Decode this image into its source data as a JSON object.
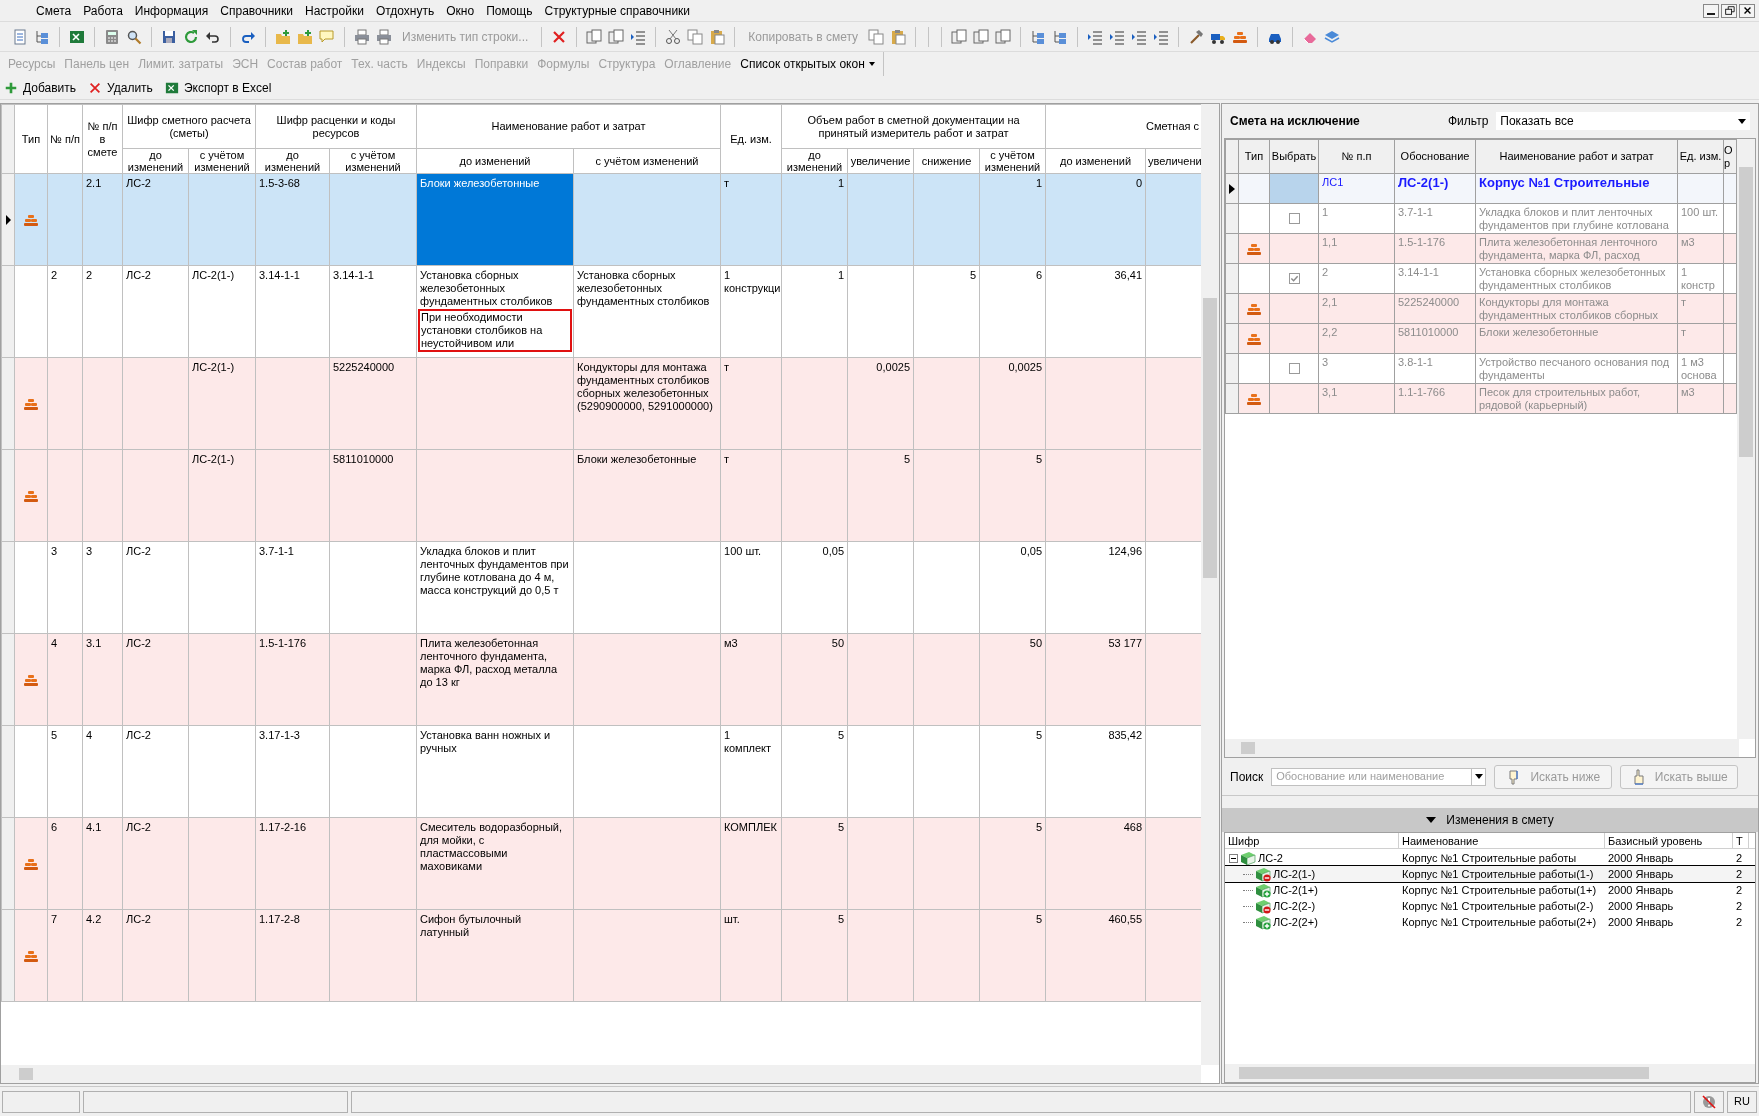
{
  "menu": [
    "Смета",
    "Работа",
    "Информация",
    "Справочники",
    "Настройки",
    "Отдохнуть",
    "Окно",
    "Помощь",
    "Структурные справочники"
  ],
  "toolbar": {
    "buttons": [
      {
        "label": "Изменить тип строки...",
        "disabled": true
      },
      {
        "label": "Копировать в смету",
        "disabled": true
      }
    ]
  },
  "panel_tabs": [
    {
      "label": "Ресурсы",
      "disabled": true
    },
    {
      "label": "Панель цен",
      "disabled": true
    },
    {
      "label": "Лимит. затраты",
      "disabled": true
    },
    {
      "label": "ЭСН",
      "disabled": true
    },
    {
      "label": "Состав работ",
      "disabled": true
    },
    {
      "label": "Тех. часть",
      "disabled": true
    },
    {
      "label": "Индексы",
      "disabled": true
    },
    {
      "label": "Поправки",
      "disabled": true
    },
    {
      "label": "Формулы",
      "disabled": true
    },
    {
      "label": "Структура",
      "disabled": true
    },
    {
      "label": "Оглавление",
      "disabled": true
    }
  ],
  "open_windows_menu": {
    "label": "Список открытых окон"
  },
  "actions": [
    {
      "label": "Добавить",
      "kind": "add"
    },
    {
      "label": "Удалить",
      "kind": "delete"
    },
    {
      "label": "Экспорт в Excel",
      "kind": "excel"
    }
  ],
  "table": {
    "columns": [
      {
        "label": "Тип"
      },
      {
        "label": "№ п/п"
      },
      {
        "label": "№ п/п в смете"
      },
      {
        "label": "Шифр сметного расчета (сметы)",
        "sub": [
          "до изменений",
          "с учётом изменений"
        ]
      },
      {
        "label": "Шифр расценки и коды ресурсов",
        "sub": [
          "до изменений",
          "с учётом изменений"
        ]
      },
      {
        "label": "Наименование работ и затрат",
        "sub": [
          "до изменений",
          "с учётом изменений"
        ]
      },
      {
        "label": "Ед. изм."
      },
      {
        "label": "Объем работ в сметной документации на принятый измеритель работ и затрат",
        "sub": [
          "до изменений",
          "увеличение",
          "снижение",
          "с учётом изменений"
        ]
      },
      {
        "label": "Сметная с",
        "sub": [
          "до изменений",
          "увеличени"
        ]
      }
    ],
    "rows": [
      {
        "kind": "resource",
        "selected": true,
        "num_est": "2.1",
        "est_before": "ЛС-2",
        "rate_before": "1.5-3-68",
        "name_before": "Блоки железобетонные",
        "unit": "т",
        "vol_before": "1",
        "vol_after": "1",
        "cost_before": "0"
      },
      {
        "kind": "work",
        "selected": false,
        "num": "2",
        "num_est": "2",
        "est_before": "ЛС-2",
        "est_after": "ЛС-2(1-)",
        "rate_before": "3.14-1-1",
        "rate_after": "3.14-1-1",
        "name_before": "Установка сборных железобетонных фундаментных столбиков",
        "note": "При необходимости установки столбиков на неустойчивом или",
        "name_after": "Установка сборных железобетонных фундаментных столбиков",
        "unit": "1 конструкци",
        "vol_before": "1",
        "vol_dec": "5",
        "vol_after": "6",
        "cost_before": "36,41"
      },
      {
        "kind": "resource",
        "selected": false,
        "est_after": "ЛС-2(1-)",
        "rate_after": "5225240000",
        "name_after": "Кондукторы для монтажа фундаментных столбиков сборных железобетонных (5290900000, 5291000000)",
        "unit": "т",
        "vol_inc": "0,0025",
        "vol_after": "0,0025"
      },
      {
        "kind": "resource",
        "selected": false,
        "est_after": "ЛС-2(1-)",
        "rate_after": "5811010000",
        "name_after": "Блоки железобетонные",
        "unit": "т",
        "vol_inc": "5",
        "vol_after": "5"
      },
      {
        "kind": "work",
        "selected": false,
        "num": "3",
        "num_est": "3",
        "est_before": "ЛС-2",
        "rate_before": "3.7-1-1",
        "name_before": "Укладка блоков и плит ленточных фундаментов при глубине котлована до 4 м, масса конструкций до 0,5 т",
        "unit": "100 шт.",
        "vol_before": "0,05",
        "vol_after": "0,05",
        "cost_before": "124,96"
      },
      {
        "kind": "resource",
        "selected": false,
        "num": "4",
        "num_est": "3.1",
        "est_before": "ЛС-2",
        "rate_before": "1.5-1-176",
        "name_before": "Плита железобетонная ленточного фундамента, марка ФЛ, расход металла до 13 кг",
        "unit": "м3",
        "vol_before": "50",
        "vol_after": "50",
        "cost_before": "53 177"
      },
      {
        "kind": "work",
        "selected": false,
        "num": "5",
        "num_est": "4",
        "est_before": "ЛС-2",
        "rate_before": "3.17-1-3",
        "name_before": "Установка ванн ножных и ручных",
        "unit": "1 комплект",
        "vol_before": "5",
        "vol_after": "5",
        "cost_before": "835,42"
      },
      {
        "kind": "resource",
        "selected": false,
        "num": "6",
        "num_est": "4.1",
        "est_before": "ЛС-2",
        "rate_before": "1.17-2-16",
        "name_before": "Смеситель водоразборный, для мойки, с пластмассовыми маховиками",
        "unit": "КОМПЛЕК",
        "vol_before": "5",
        "vol_after": "5",
        "cost_before": "468"
      },
      {
        "kind": "resource",
        "selected": false,
        "num": "7",
        "num_est": "4.2",
        "est_before": "ЛС-2",
        "rate_before": "1.17-2-8",
        "name_before": "Сифон бутылочный латунный",
        "unit": "шт.",
        "vol_before": "5",
        "vol_after": "5",
        "cost_before": "460,55"
      }
    ]
  },
  "exclusion_panel": {
    "title": "Смета на исключение",
    "filter_label": "Фильтр",
    "filter_value": "Показать все",
    "columns": [
      "Тип",
      "Выбрать",
      "№ п.п",
      "Обоснование",
      "Наименование работ и затрат",
      "Ед. изм.",
      "О р"
    ],
    "rows": [
      {
        "kind": "group",
        "selected": true,
        "num": "ЛС1",
        "basis": "ЛС-2(1-)",
        "name": "Корпус №1 Строительные"
      },
      {
        "kind": "work",
        "selected": false,
        "checked": false,
        "num": "1",
        "basis": "3.7-1-1",
        "name": "Укладка блоков и плит ленточных фундаментов при глубине котлована",
        "unit": "100 шт."
      },
      {
        "kind": "resource",
        "selected": false,
        "num": "1,1",
        "basis": "1.5-1-176",
        "name": "Плита железобетонная ленточного фундамента, марка ФЛ, расход",
        "unit": "м3"
      },
      {
        "kind": "work",
        "selected": false,
        "checked": true,
        "num": "2",
        "basis": "3.14-1-1",
        "name": "Установка сборных железобетонных фундаментных столбиков",
        "unit": "1 констр"
      },
      {
        "kind": "resource",
        "selected": false,
        "num": "2,1",
        "basis": "5225240000",
        "name": "Кондукторы для монтажа фундаментных столбиков сборных",
        "unit": "т"
      },
      {
        "kind": "resource",
        "selected": false,
        "num": "2,2",
        "basis": "5811010000",
        "name": "Блоки железобетонные",
        "unit": "т"
      },
      {
        "kind": "work",
        "selected": false,
        "checked": false,
        "num": "3",
        "basis": "3.8-1-1",
        "name": "Устройство песчаного основания под фундаменты",
        "unit": "1 м3 основа"
      },
      {
        "kind": "resource",
        "selected": false,
        "num": "3,1",
        "basis": "1.1-1-766",
        "name": "Песок для строительных работ, рядовой (карьерный)",
        "unit": "м3"
      }
    ],
    "search": {
      "label": "Поиск",
      "placeholder": "Обоснование или наименование",
      "buttons": [
        {
          "label": "Искать ниже",
          "kind": "down",
          "disabled": true
        },
        {
          "label": "Искать выше",
          "kind": "up",
          "disabled": true
        }
      ]
    }
  },
  "changes_panel": {
    "title": "Изменения в смету",
    "expanded": true,
    "columns": [
      "Шифр",
      "Наименование",
      "Базисный уровень",
      "Т"
    ],
    "tree": [
      {
        "kind": "estimate",
        "code": "ЛС-2",
        "name": "Корпус №1 Строительные работы",
        "level": "2000 Январь",
        "column_4": "2",
        "selected": false,
        "expanded": true,
        "children": [
          {
            "kind": "minus",
            "code": "ЛС-2(1-)",
            "name": "Корпус №1 Строительные работы(1-)",
            "level": "2000 Январь",
            "column_4": "2",
            "selected": true
          },
          {
            "kind": "plus",
            "code": "ЛС-2(1+)",
            "name": "Корпус №1 Строительные работы(1+)",
            "level": "2000 Январь",
            "column_4": "2",
            "selected": false
          },
          {
            "kind": "minus",
            "code": "ЛС-2(2-)",
            "name": "Корпус №1 Строительные работы(2-)",
            "level": "2000 Январь",
            "column_4": "2",
            "selected": false
          },
          {
            "kind": "plus",
            "code": "ЛС-2(2+)",
            "name": "Корпус №1 Строительные работы(2+)",
            "level": "2000 Январь",
            "column_4": "2",
            "selected": false
          }
        ]
      }
    ]
  },
  "status_bar": {
    "language": "RU"
  }
}
